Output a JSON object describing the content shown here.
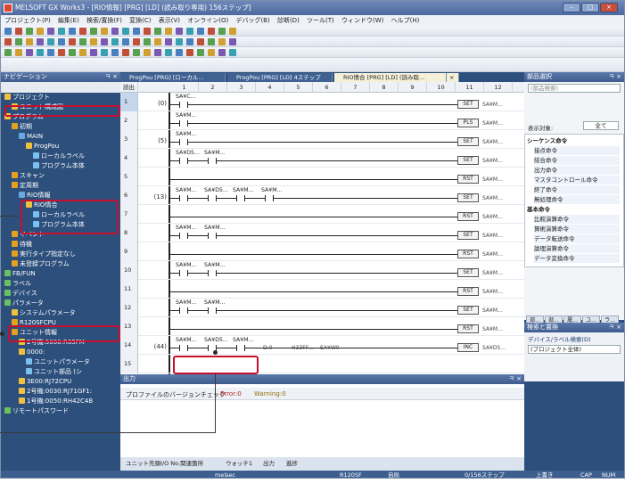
{
  "window": {
    "title": "MELSOFT GX Works3 - [RIO情報] [PRG] [LD] (読み取り専用) 156ステップ]",
    "title_left": "MELSOFT GX Works3 ...",
    "title_right": ".gx3 - [RIO情報 [PRG] [LD] (読み取り専用) 156ステップ]",
    "min": "–",
    "max": "□",
    "close": "×"
  },
  "menu": [
    "プロジェクト(P)",
    "編集(E)",
    "検索/置換(F)",
    "変換(C)",
    "表示(V)",
    "オンライン(O)",
    "デバッグ(B)",
    "診断(D)",
    "ツール(T)",
    "ウィンドウ(W)",
    "ヘルプ(H)"
  ],
  "nav": {
    "title": "ナビゲーション",
    "pin": "ㅋ ×",
    "tree": [
      {
        "label": "プロジェクト",
        "level": 0,
        "color": "#f0c040"
      },
      {
        "label": "ユニット構成図",
        "level": 1,
        "color": "#f0c040"
      },
      {
        "label": "プログラム",
        "level": 0,
        "color": "#f0c040"
      },
      {
        "label": "初期",
        "level": 1,
        "color": "#e4a020"
      },
      {
        "label": "MAIN",
        "level": 2,
        "color": "#6aa8e0"
      },
      {
        "label": "ProgPou",
        "level": 3,
        "color": "#f0c040"
      },
      {
        "label": "ローカルラベル",
        "level": 4,
        "color": "#7ac0f0"
      },
      {
        "label": "プログラム本体",
        "level": 4,
        "color": "#7ac0f0"
      },
      {
        "label": "スキャン",
        "level": 1,
        "color": "#e4a020"
      },
      {
        "label": "定周期",
        "level": 1,
        "color": "#e4a020"
      },
      {
        "label": "RIO情報",
        "level": 2,
        "color": "#6aa8e0"
      },
      {
        "label": "RIO情合",
        "level": 3,
        "color": "#f0c040"
      },
      {
        "label": "ローカルラベル",
        "level": 4,
        "color": "#7ac0f0"
      },
      {
        "label": "プログラム本体",
        "level": 4,
        "color": "#7ac0f0"
      },
      {
        "label": "イベント",
        "level": 1,
        "color": "#e4a020"
      },
      {
        "label": "待機",
        "level": 1,
        "color": "#e4a020"
      },
      {
        "label": "実行タイプ指定なし",
        "level": 1,
        "color": "#e4a020"
      },
      {
        "label": "未登録プログラム",
        "level": 1,
        "color": "#e4a020"
      },
      {
        "label": "FB/FUN",
        "level": 0,
        "color": "#6ac060"
      },
      {
        "label": "ラベル",
        "level": 0,
        "color": "#6ac060"
      },
      {
        "label": "デバイス",
        "level": 0,
        "color": "#6ac060"
      },
      {
        "label": "パラメータ",
        "level": 0,
        "color": "#6ac060"
      },
      {
        "label": "システムパラメータ",
        "level": 1,
        "color": "#f0c040"
      },
      {
        "label": "R120SFCPU",
        "level": 1,
        "color": "#e4a020"
      },
      {
        "label": "ユニット情報",
        "level": 1,
        "color": "#e4a020"
      },
      {
        "label": "2号機:0000:R65FM",
        "level": 2,
        "color": "#f0c040"
      },
      {
        "label": "0000:",
        "level": 2,
        "color": "#f0c040"
      },
      {
        "label": "ユニットパラメータ",
        "level": 3,
        "color": "#7ac0f0"
      },
      {
        "label": "ユニット部品 (シ",
        "level": 3,
        "color": "#7ac0f0"
      },
      {
        "label": "3E00:RJ72CPU",
        "level": 2,
        "color": "#f0c040"
      },
      {
        "label": "2号機:0030:RJ71GF1:",
        "level": 2,
        "color": "#f0c040"
      },
      {
        "label": "1号機:0050:RH42C4B",
        "level": 2,
        "color": "#f0c040"
      },
      {
        "label": "リモートパスワード",
        "level": 0,
        "color": "#6ac060"
      }
    ]
  },
  "tabs": [
    "ProgPou [PRG] [ローカル...",
    "ProgPou [PRG] [LD] 4ステップ",
    "RIO情合 [PRG] [LD] (読み取...",
    "×"
  ],
  "ladder": {
    "header_left": "読出し",
    "columns": [
      "1",
      "2",
      "3",
      "4",
      "5",
      "6",
      "7",
      "8",
      "9",
      "10",
      "11",
      "12"
    ],
    "rows": [
      {
        "num": "1",
        "step": "(0)",
        "contacts": [
          "SA¥C…"
        ],
        "coil": "SET",
        "target": "SA¥M…"
      },
      {
        "num": "2",
        "step": "",
        "contacts": [
          "SA¥M…"
        ],
        "coil": "PLS",
        "target": "SA¥M…"
      },
      {
        "num": "3",
        "step": "(5)",
        "contacts": [
          "SA¥M…"
        ],
        "coil": "SET",
        "target": "SA¥M…"
      },
      {
        "num": "4",
        "step": "",
        "contacts": [
          "SA¥D5…",
          "SA¥M…"
        ],
        "coil": "SET",
        "target": "SA¥M…"
      },
      {
        "num": "5",
        "step": "",
        "contacts": [],
        "coil": "RST",
        "target": "SA¥M…"
      },
      {
        "num": "6",
        "step": "(13)",
        "contacts": [
          "SA¥M…",
          "SA¥D5…",
          "SA¥M…",
          "SA¥M…"
        ],
        "coil": "SET",
        "target": "SA¥M…"
      },
      {
        "num": "7",
        "step": "",
        "contacts": [],
        "coil": "RST",
        "target": "SA¥M…"
      },
      {
        "num": "8",
        "step": "",
        "contacts": [
          "SA¥M…",
          "SA¥M…"
        ],
        "coil": "SET",
        "target": "SA¥M…"
      },
      {
        "num": "9",
        "step": "",
        "contacts": [],
        "coil": "RST",
        "target": "SA¥M…"
      },
      {
        "num": "10",
        "step": "",
        "contacts": [
          "SA¥M…",
          "SA¥M…"
        ],
        "coil": "SET",
        "target": "SA¥M…"
      },
      {
        "num": "11",
        "step": "",
        "contacts": [],
        "coil": "RST",
        "target": "SA¥M…"
      },
      {
        "num": "12",
        "step": "",
        "contacts": [
          "SA¥M…",
          "SA¥M…"
        ],
        "coil": "SET",
        "target": "SA¥M…"
      },
      {
        "num": "13",
        "step": "",
        "contacts": [],
        "coil": "RST",
        "target": "SA¥M…"
      },
      {
        "num": "14",
        "step": "(44)",
        "contacts": [
          "SA¥M…",
          "SA¥D5…",
          "SA¥M…"
        ],
        "coil": "INC",
        "target": "SA¥D5…",
        "mid": "D:0",
        "mid2": "H33FF…",
        "mid3": "SA¥W0"
      },
      {
        "num": "15",
        "step": "",
        "contacts": [],
        "coil": "",
        "target": ""
      }
    ]
  },
  "parts": {
    "title": "部品選択",
    "search_placeholder": "(部品検索)",
    "display_label": "表示対象:",
    "display_value": "全て",
    "items": [
      {
        "t": "シーケンス命令",
        "h": true
      },
      {
        "t": "接点命令",
        "h": false
      },
      {
        "t": "結合命令",
        "h": false
      },
      {
        "t": "出力命令",
        "h": false
      },
      {
        "t": "マスタコントロール命令",
        "h": false
      },
      {
        "t": "終了命令",
        "h": false
      },
      {
        "t": "無処理命令",
        "h": false
      },
      {
        "t": "基本命令",
        "h": true
      },
      {
        "t": "比較演算命令",
        "h": false
      },
      {
        "t": "算術演算命令",
        "h": false
      },
      {
        "t": "データ転送命令",
        "h": false
      },
      {
        "t": "論理演算命令",
        "h": false
      },
      {
        "t": "データ変換命令",
        "h": false
      }
    ],
    "bottom_tabs": [
      "部...",
      "部...",
      "履...",
      "ユ...",
      "ラ..."
    ]
  },
  "search": {
    "title": "検索と置換",
    "pin": "ㅋ ×",
    "mode": "デバイス/ラベル検索(D)",
    "scope": "(プロジェクト全体)"
  },
  "output": {
    "title": "出力",
    "pin": "ㅋ ×",
    "message": "プロファイルのバージョンチェック",
    "errors": "Error:0",
    "warnings": "Warning:0"
  },
  "bottom_tabs": [
    "ユニット先頭I/O No.関連箇所",
    "ウォッチ1",
    "出力",
    "進捗"
  ],
  "status": {
    "mode": "melsec",
    "cpu": "R120SF",
    "host": "自局",
    "steps": "0/156ステップ",
    "ow": "上書き",
    "cap": "CAP",
    "num": "NUM"
  }
}
